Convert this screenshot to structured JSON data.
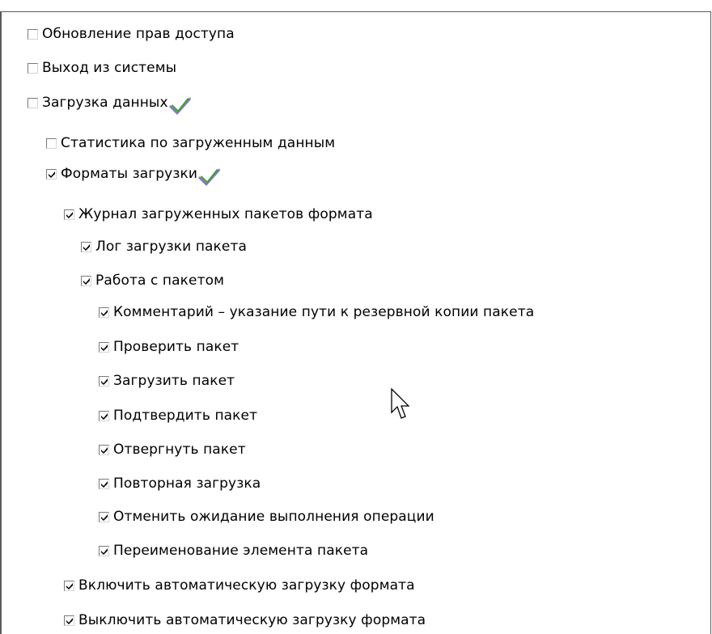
{
  "items": [
    {
      "label": "Обновление прав доступа",
      "checked": false
    },
    {
      "label": "Выход из системы",
      "checked": false
    },
    {
      "label": "Загрузка данных",
      "checked": false,
      "status_icon": "green-check-icon"
    },
    {
      "label": "Статистика по загруженным данным",
      "checked": false
    },
    {
      "label": "Форматы загрузки",
      "checked": true,
      "status_icon": "green-check-icon"
    },
    {
      "label": "Журнал загруженных пакетов формата",
      "checked": true
    },
    {
      "label": "Лог загрузки пакета",
      "checked": true
    },
    {
      "label": "Работа с пакетом",
      "checked": true
    },
    {
      "label": "Комментарий – указание пути к резервной копии пакета",
      "checked": true
    },
    {
      "label": "Проверить пакет",
      "checked": true
    },
    {
      "label": "Загрузить пакет",
      "checked": true
    },
    {
      "label": "Подтвердить пакет",
      "checked": true
    },
    {
      "label": "Отвергнуть пакет",
      "checked": true
    },
    {
      "label": "Повторная загрузка",
      "checked": true
    },
    {
      "label": "Отменить ожидание выполнения операции",
      "checked": true
    },
    {
      "label": "Переименование элемента пакета",
      "checked": true
    },
    {
      "label": "Включить автоматическую загрузку формата",
      "checked": true
    },
    {
      "label": "Выключить автоматическую загрузку формата",
      "checked": true
    }
  ],
  "colors": {
    "check_mark": "#000000",
    "status_check_green": "#3aa52f",
    "status_check_purple": "#8a74c9",
    "frame_border": "#5b5b5b"
  },
  "cursor_icon": "arrow-cursor-icon"
}
